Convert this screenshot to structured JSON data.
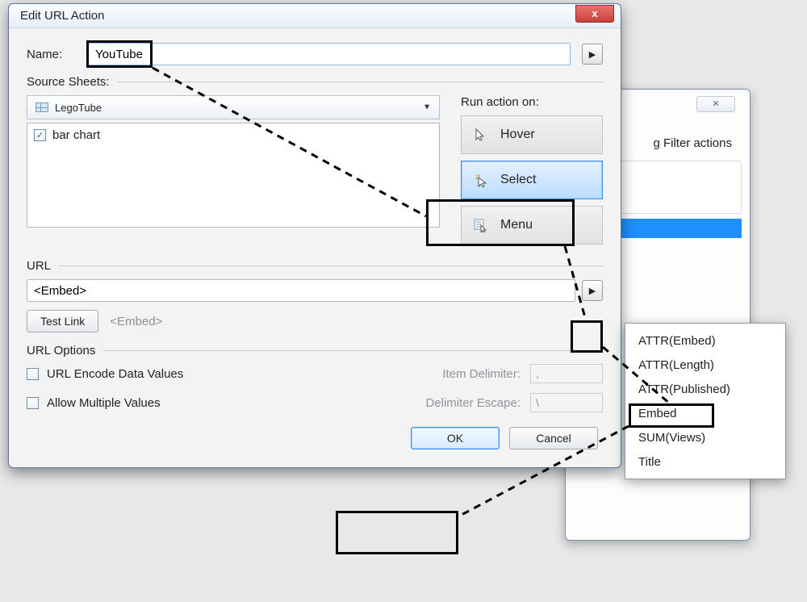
{
  "dialog": {
    "title": "Edit URL Action",
    "name_label": "Name:",
    "name_value": "YouTube",
    "source_sheets_label": "Source Sheets:",
    "sheet_selected": "LegoTube",
    "list_items": [
      {
        "label": "bar chart",
        "checked": true
      }
    ],
    "run_action_label": "Run action on:",
    "run_buttons": {
      "hover": "Hover",
      "select": "Select",
      "menu": "Menu"
    },
    "url_section": "URL",
    "url_value": "<Embed>",
    "test_link": "Test Link",
    "test_link_hint": "<Embed>",
    "url_options_section": "URL Options",
    "url_encode": "URL Encode Data Values",
    "allow_multi": "Allow Multiple Values",
    "item_delim_label": "Item Delimiter:",
    "item_delim_value": ",",
    "esc_label": "Delimiter Escape:",
    "esc_value": "\\",
    "ok": "OK",
    "cancel": "Cancel",
    "close_glyph": "x"
  },
  "fields_menu": {
    "items": [
      "ATTR(Embed)",
      "ATTR(Length)",
      "ATTR(Published)",
      "Embed",
      "SUM(Views)",
      "Title"
    ]
  },
  "bg_dialog": {
    "fragment": "g Filter actions",
    "close_glyph": "✕"
  }
}
